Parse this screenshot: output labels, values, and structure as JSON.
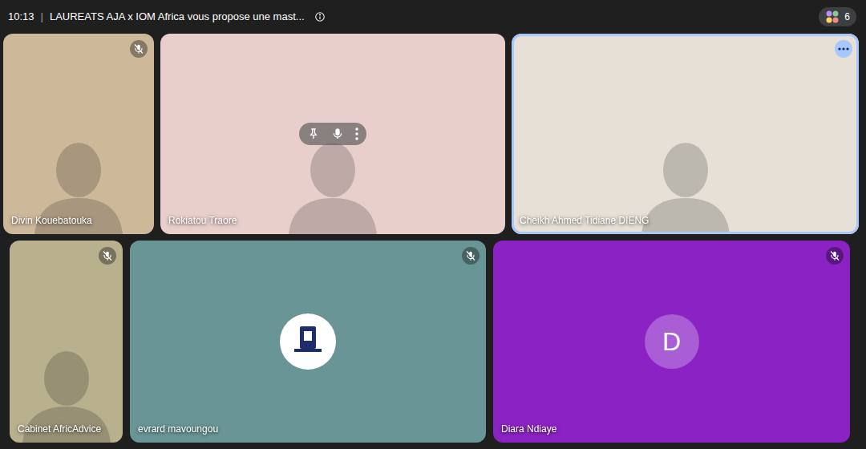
{
  "window": {
    "time": "10:13",
    "separator": "|",
    "title": "LAUREATS AJA x IOM Africa vous propose une mast..."
  },
  "participants": {
    "count": "6"
  },
  "tiles": [
    {
      "name": "Divin Kouebatouka",
      "kind": "video",
      "muted": true,
      "active": false,
      "hovered": false,
      "color": "#cdb89a"
    },
    {
      "name": "Rokiatou Traore",
      "kind": "video",
      "muted": false,
      "active": false,
      "hovered": true,
      "color": "#e9cfcb"
    },
    {
      "name": "Cheikh Ahmed Tidiane DIENG",
      "kind": "video",
      "muted": false,
      "active": true,
      "hovered": false,
      "color": "#e6e0d6"
    },
    {
      "name": "Cabinet AfricAdvice",
      "kind": "video",
      "muted": true,
      "active": false,
      "hovered": false,
      "color": "#b9b08e"
    },
    {
      "name": "evrard mavoungou",
      "kind": "logo",
      "muted": true,
      "active": false,
      "hovered": false,
      "color": "#6a9596"
    },
    {
      "name": "Diara Ndiaye",
      "kind": "avatar",
      "letter": "D",
      "muted": true,
      "active": false,
      "hovered": false,
      "color": "#8b23c4"
    }
  ]
}
